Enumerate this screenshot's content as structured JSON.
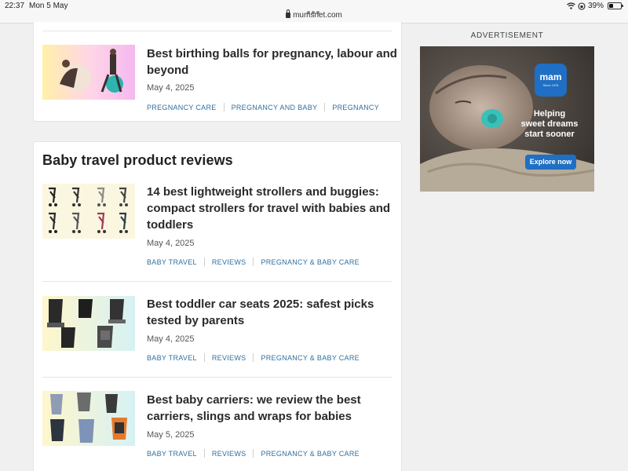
{
  "status_bar": {
    "time": "22:37",
    "date": "Mon 5 May",
    "url": "mumsnet.com",
    "battery": "39%",
    "battery_level": 0.39
  },
  "top_article": {
    "title": "Best birthing balls for pregnancy, labour and beyond",
    "date": "May 4, 2025",
    "tags": [
      "PREGNANCY CARE",
      "PREGNANCY AND BABY",
      "PREGNANCY"
    ]
  },
  "section": {
    "title": "Baby travel product reviews",
    "articles": [
      {
        "title": "14 best lightweight strollers and buggies: compact strollers for travel with babies and toddlers",
        "date": "May 4, 2025",
        "tags": [
          "BABY TRAVEL",
          "REVIEWS",
          "PREGNANCY & BABY CARE"
        ]
      },
      {
        "title": "Best toddler car seats 2025: safest picks tested by parents",
        "date": "May 4, 2025",
        "tags": [
          "BABY TRAVEL",
          "REVIEWS",
          "PREGNANCY & BABY CARE"
        ]
      },
      {
        "title": "Best baby carriers: we review the best carriers, slings and wraps for babies",
        "date": "May 5, 2025",
        "tags": [
          "BABY TRAVEL",
          "REVIEWS",
          "PREGNANCY & BABY CARE"
        ]
      }
    ]
  },
  "ad": {
    "label": "ADVERTISEMENT",
    "brand": "mam",
    "brand_sub": "Since 1976",
    "tagline": [
      "Helping",
      "sweet dreams",
      "start sooner"
    ],
    "cta": "Explore now"
  },
  "colors": {
    "tag_link": "#2f6f9f",
    "ad_brand_blue": "#1f6fc4"
  }
}
